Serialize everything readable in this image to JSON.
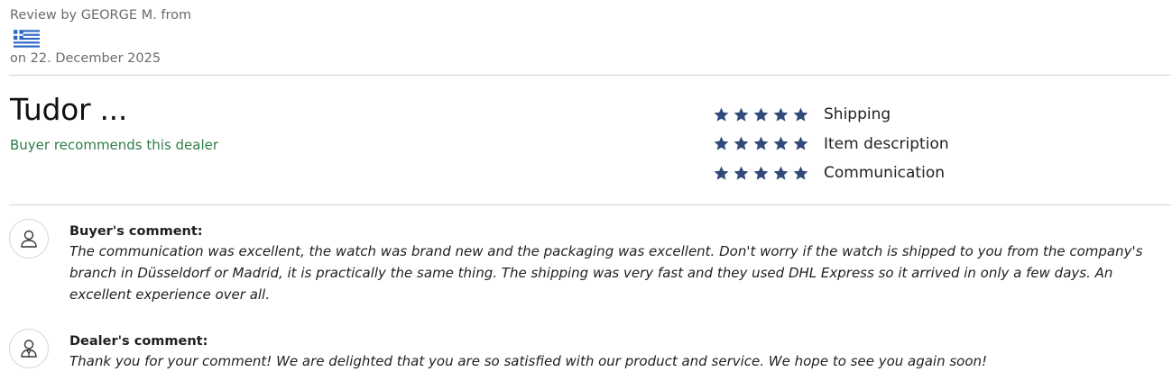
{
  "review": {
    "reviewer_line": "Review by GEORGE M. from",
    "country_flag_icon": "greece-flag-icon",
    "date_line": "on 22. December 2025",
    "title": "Tudor ...",
    "recommendation": "Buyer recommends this dealer"
  },
  "ratings": [
    {
      "label": "Shipping",
      "stars": 5,
      "max": 5
    },
    {
      "label": "Item description",
      "stars": 5,
      "max": 5
    },
    {
      "label": "Communication",
      "stars": 5,
      "max": 5
    }
  ],
  "buyer_comment": {
    "title": "Buyer's comment:",
    "text": "The communication was excellent, the watch was brand new and the packaging was excellent. Don't worry if the watch is shipped to you from the company's branch in Düsseldorf or Madrid, it is practically the same thing. The shipping was very fast and they used DHL Express so it arrived in only a few days. An excellent experience over all.",
    "icon": "user-icon"
  },
  "dealer_comment": {
    "title": "Dealer's comment:",
    "text": "Thank you for your comment! We are delighted that you are so satisfied with our product and service. We hope to see you again soon!",
    "icon": "dealer-icon"
  },
  "colors": {
    "star": "#324a7a",
    "recommend": "#2e7d4a",
    "meta_text": "#6b6b6b",
    "divider": "#d3d3d3",
    "flag_blue": "#2a66c4"
  }
}
